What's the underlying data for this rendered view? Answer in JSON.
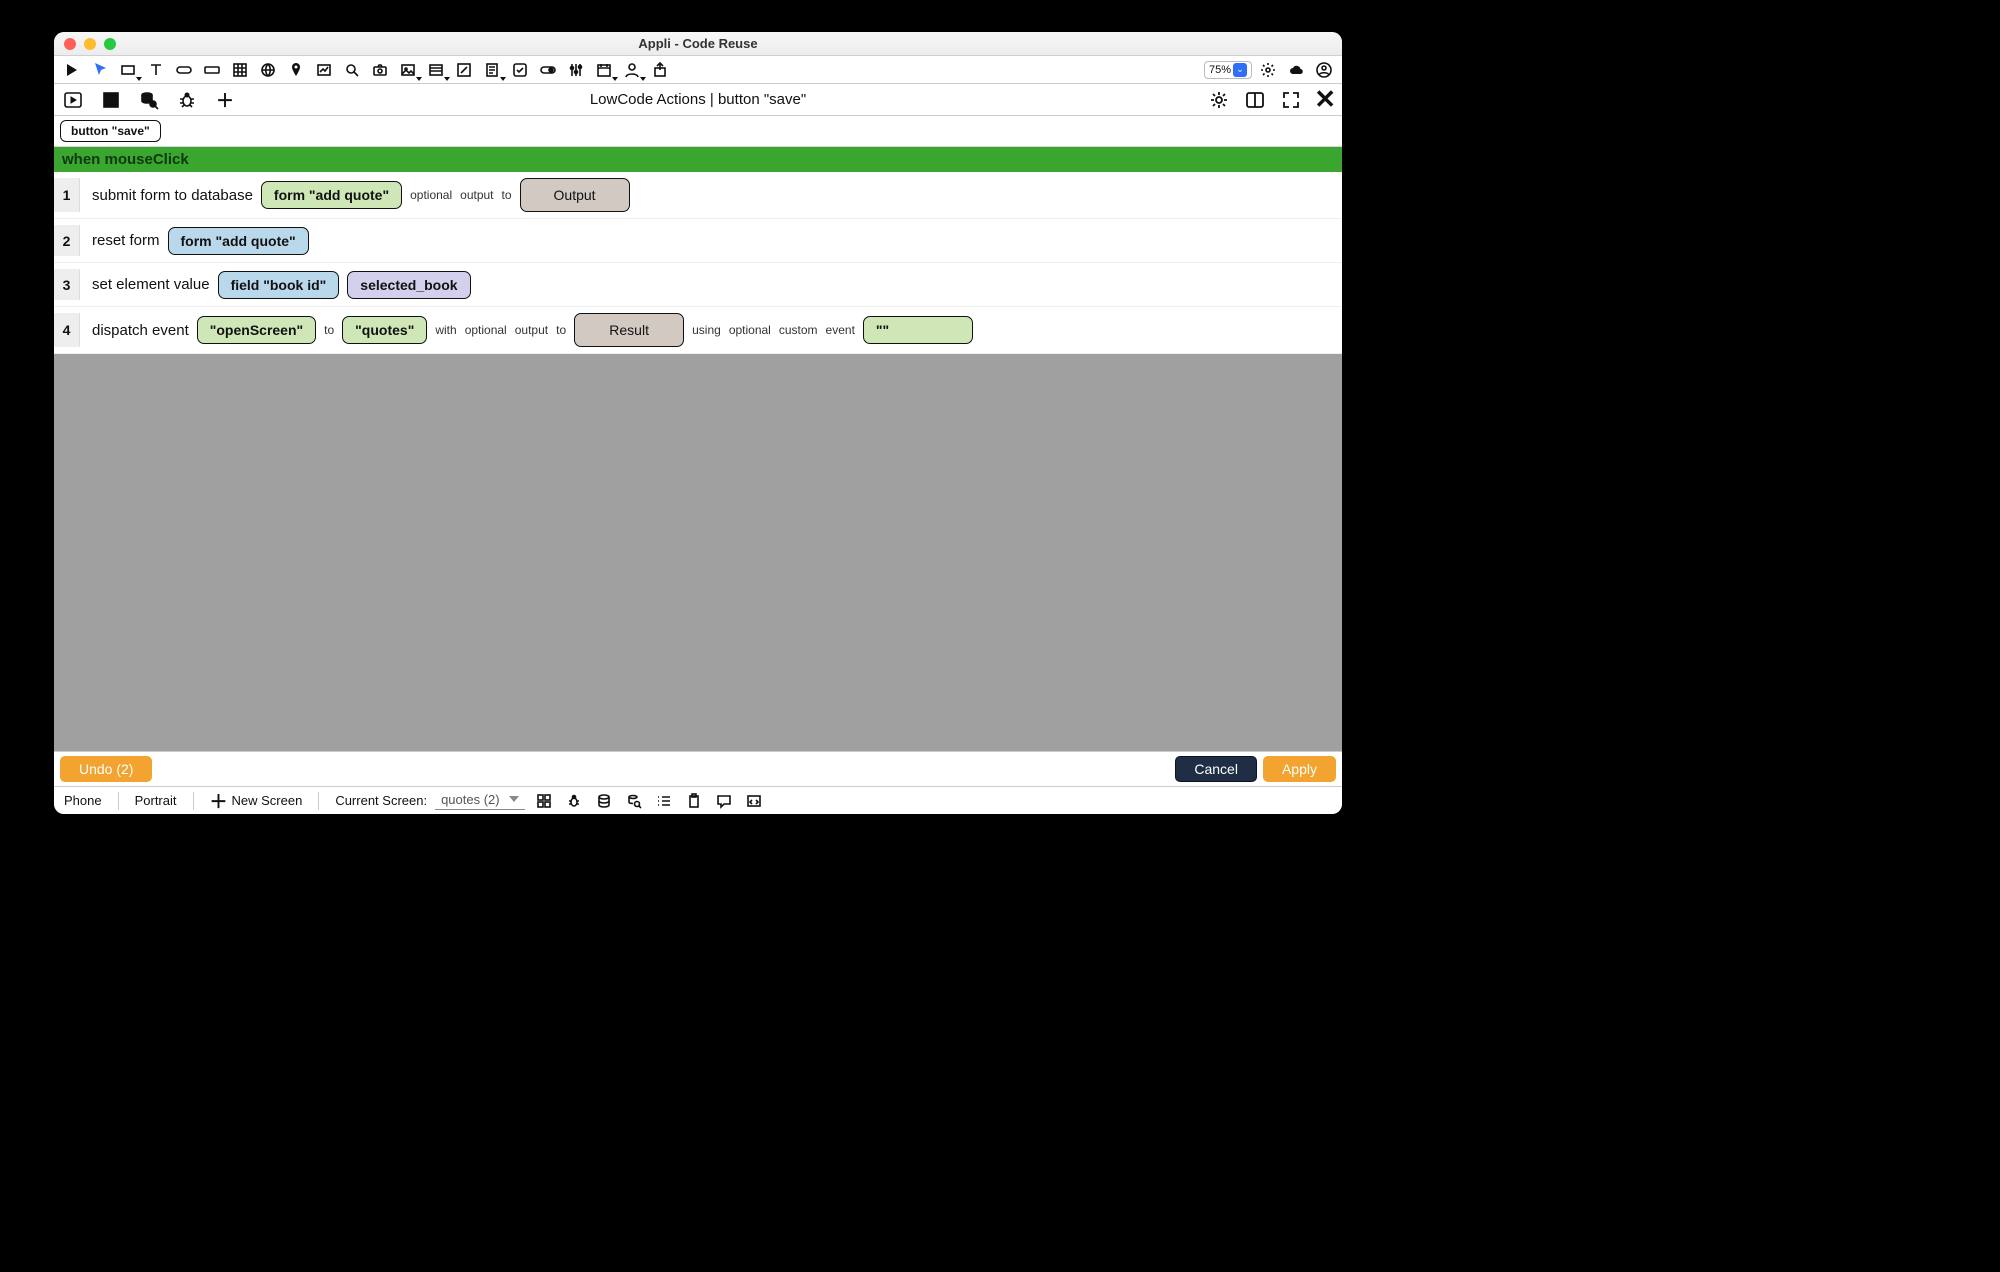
{
  "window": {
    "title": "Appli - Code Reuse"
  },
  "toolbar": {
    "zoom": "75%",
    "icons": [
      "play",
      "pointer",
      "rect",
      "text",
      "button",
      "input",
      "table",
      "globe",
      "pin",
      "chart",
      "search",
      "camera",
      "image",
      "list",
      "edit",
      "form",
      "check",
      "toggle",
      "sliders",
      "calendar",
      "user",
      "export"
    ]
  },
  "secbar": {
    "title": "LowCode Actions | button \"save\""
  },
  "breadcrumb": {
    "chip": "button \"save\""
  },
  "event": {
    "header": "when mouseClick"
  },
  "rows": [
    {
      "n": "1",
      "cmd": "submit form to database",
      "tokens": [
        {
          "style": "green",
          "text": "form \"add quote\""
        },
        {
          "kw": "optional"
        },
        {
          "kw": "output"
        },
        {
          "kw": "to"
        },
        {
          "style": "brown",
          "text": "Output"
        }
      ]
    },
    {
      "n": "2",
      "cmd": "reset form",
      "tokens": [
        {
          "style": "blue",
          "text": "form \"add quote\""
        }
      ]
    },
    {
      "n": "3",
      "cmd": "set element value",
      "tokens": [
        {
          "style": "blue",
          "text": "field \"book id\""
        },
        {
          "style": "purple",
          "text": "selected_book"
        }
      ]
    },
    {
      "n": "4",
      "cmd": "dispatch event",
      "tokens": [
        {
          "style": "green",
          "text": "\"openScreen\""
        },
        {
          "kw": "to"
        },
        {
          "style": "green",
          "text": "\"quotes\""
        },
        {
          "kw": "with"
        },
        {
          "kw": "optional"
        },
        {
          "kw": "output"
        },
        {
          "kw": "to"
        },
        {
          "style": "brown",
          "text": "Result"
        },
        {
          "kw": "using"
        },
        {
          "kw": "optional"
        },
        {
          "kw": "custom"
        },
        {
          "kw": "event"
        },
        {
          "style": "green",
          "text": "\"\""
        }
      ]
    }
  ],
  "bottom": {
    "undo": "Undo (2)",
    "cancel": "Cancel",
    "apply": "Apply"
  },
  "status": {
    "device": "Phone",
    "orientation": "Portrait",
    "newscreen": "New Screen",
    "currentscreen_label": "Current Screen:",
    "currentscreen_value": "quotes (2)"
  }
}
